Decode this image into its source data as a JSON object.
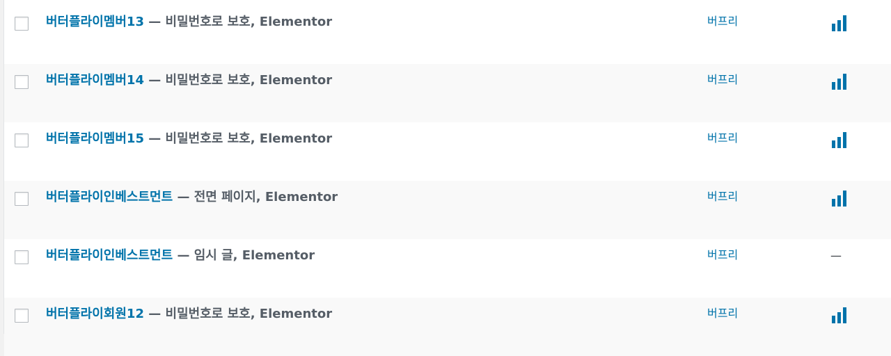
{
  "colors": {
    "link": "#0073aa",
    "state_text": "#555d66",
    "row_alt_bg": "#f9f9f9",
    "row_bg": "#ffffff",
    "seo_icon": "#0073aa"
  },
  "rows": [
    {
      "title": "버터플라이멤버13",
      "separator": " — ",
      "state": "비밀번호로 보호, Elementor",
      "author": "버프리",
      "seo": "bars-icon",
      "seo_text": ""
    },
    {
      "title": "버터플라이멤버14",
      "separator": " — ",
      "state": "비밀번호로 보호, Elementor",
      "author": "버프리",
      "seo": "bars-icon",
      "seo_text": ""
    },
    {
      "title": "버터플라이멤버15",
      "separator": " — ",
      "state": "비밀번호로 보호, Elementor",
      "author": "버프리",
      "seo": "bars-icon",
      "seo_text": ""
    },
    {
      "title": "버터플라이인베스트먼트",
      "separator": " — ",
      "state": "전면 페이지, Elementor",
      "author": "버프리",
      "seo": "bars-icon",
      "seo_text": ""
    },
    {
      "title": "버터플라이인베스트먼트",
      "separator": " — ",
      "state": "임시 글, Elementor",
      "author": "버프리",
      "seo": "none",
      "seo_text": "—"
    },
    {
      "title": "버터플라이회원12",
      "separator": " — ",
      "state": "비밀번호로 보호, Elementor",
      "author": "버프리",
      "seo": "bars-icon",
      "seo_text": ""
    }
  ]
}
